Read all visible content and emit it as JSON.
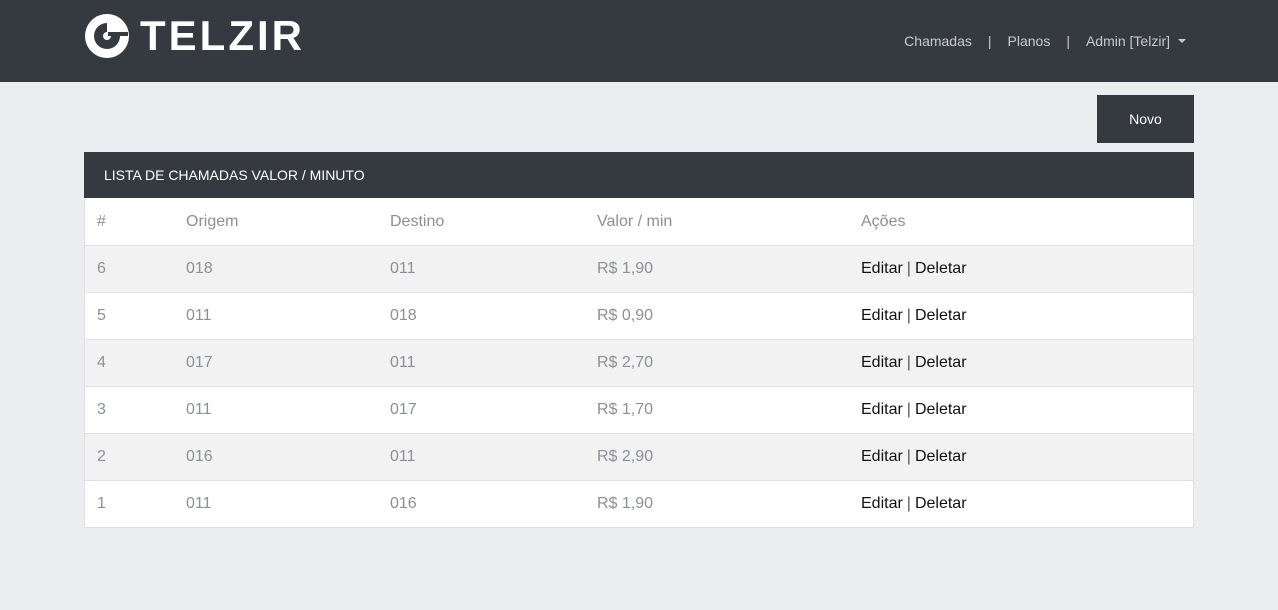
{
  "brand": {
    "name": "TELZIR",
    "icon": "telzir-logo-icon"
  },
  "nav": {
    "chamadas": "Chamadas",
    "planos": "Planos",
    "separator": "|",
    "user": "Admin [Telzir]"
  },
  "actions": {
    "novo": "Novo"
  },
  "list": {
    "title": "LISTA DE CHAMADAS VALOR / MINUTO",
    "columns": [
      "#",
      "Origem",
      "Destino",
      "Valor / min",
      "Ações"
    ],
    "edit_label": "Editar",
    "delete_label": "Deletar",
    "pipe": "|",
    "rows": [
      {
        "id": "6",
        "origem": "018",
        "destino": "011",
        "valor": "R$ 1,90"
      },
      {
        "id": "5",
        "origem": "011",
        "destino": "018",
        "valor": "R$ 0,90"
      },
      {
        "id": "4",
        "origem": "017",
        "destino": "011",
        "valor": "R$ 2,70"
      },
      {
        "id": "3",
        "origem": "011",
        "destino": "017",
        "valor": "R$ 1,70"
      },
      {
        "id": "2",
        "origem": "016",
        "destino": "011",
        "valor": "R$ 2,90"
      },
      {
        "id": "1",
        "origem": "011",
        "destino": "016",
        "valor": "R$ 1,90"
      }
    ]
  },
  "colors": {
    "dark": "#343a40",
    "background": "#ecedef",
    "stripe": "#f2f2f2"
  }
}
